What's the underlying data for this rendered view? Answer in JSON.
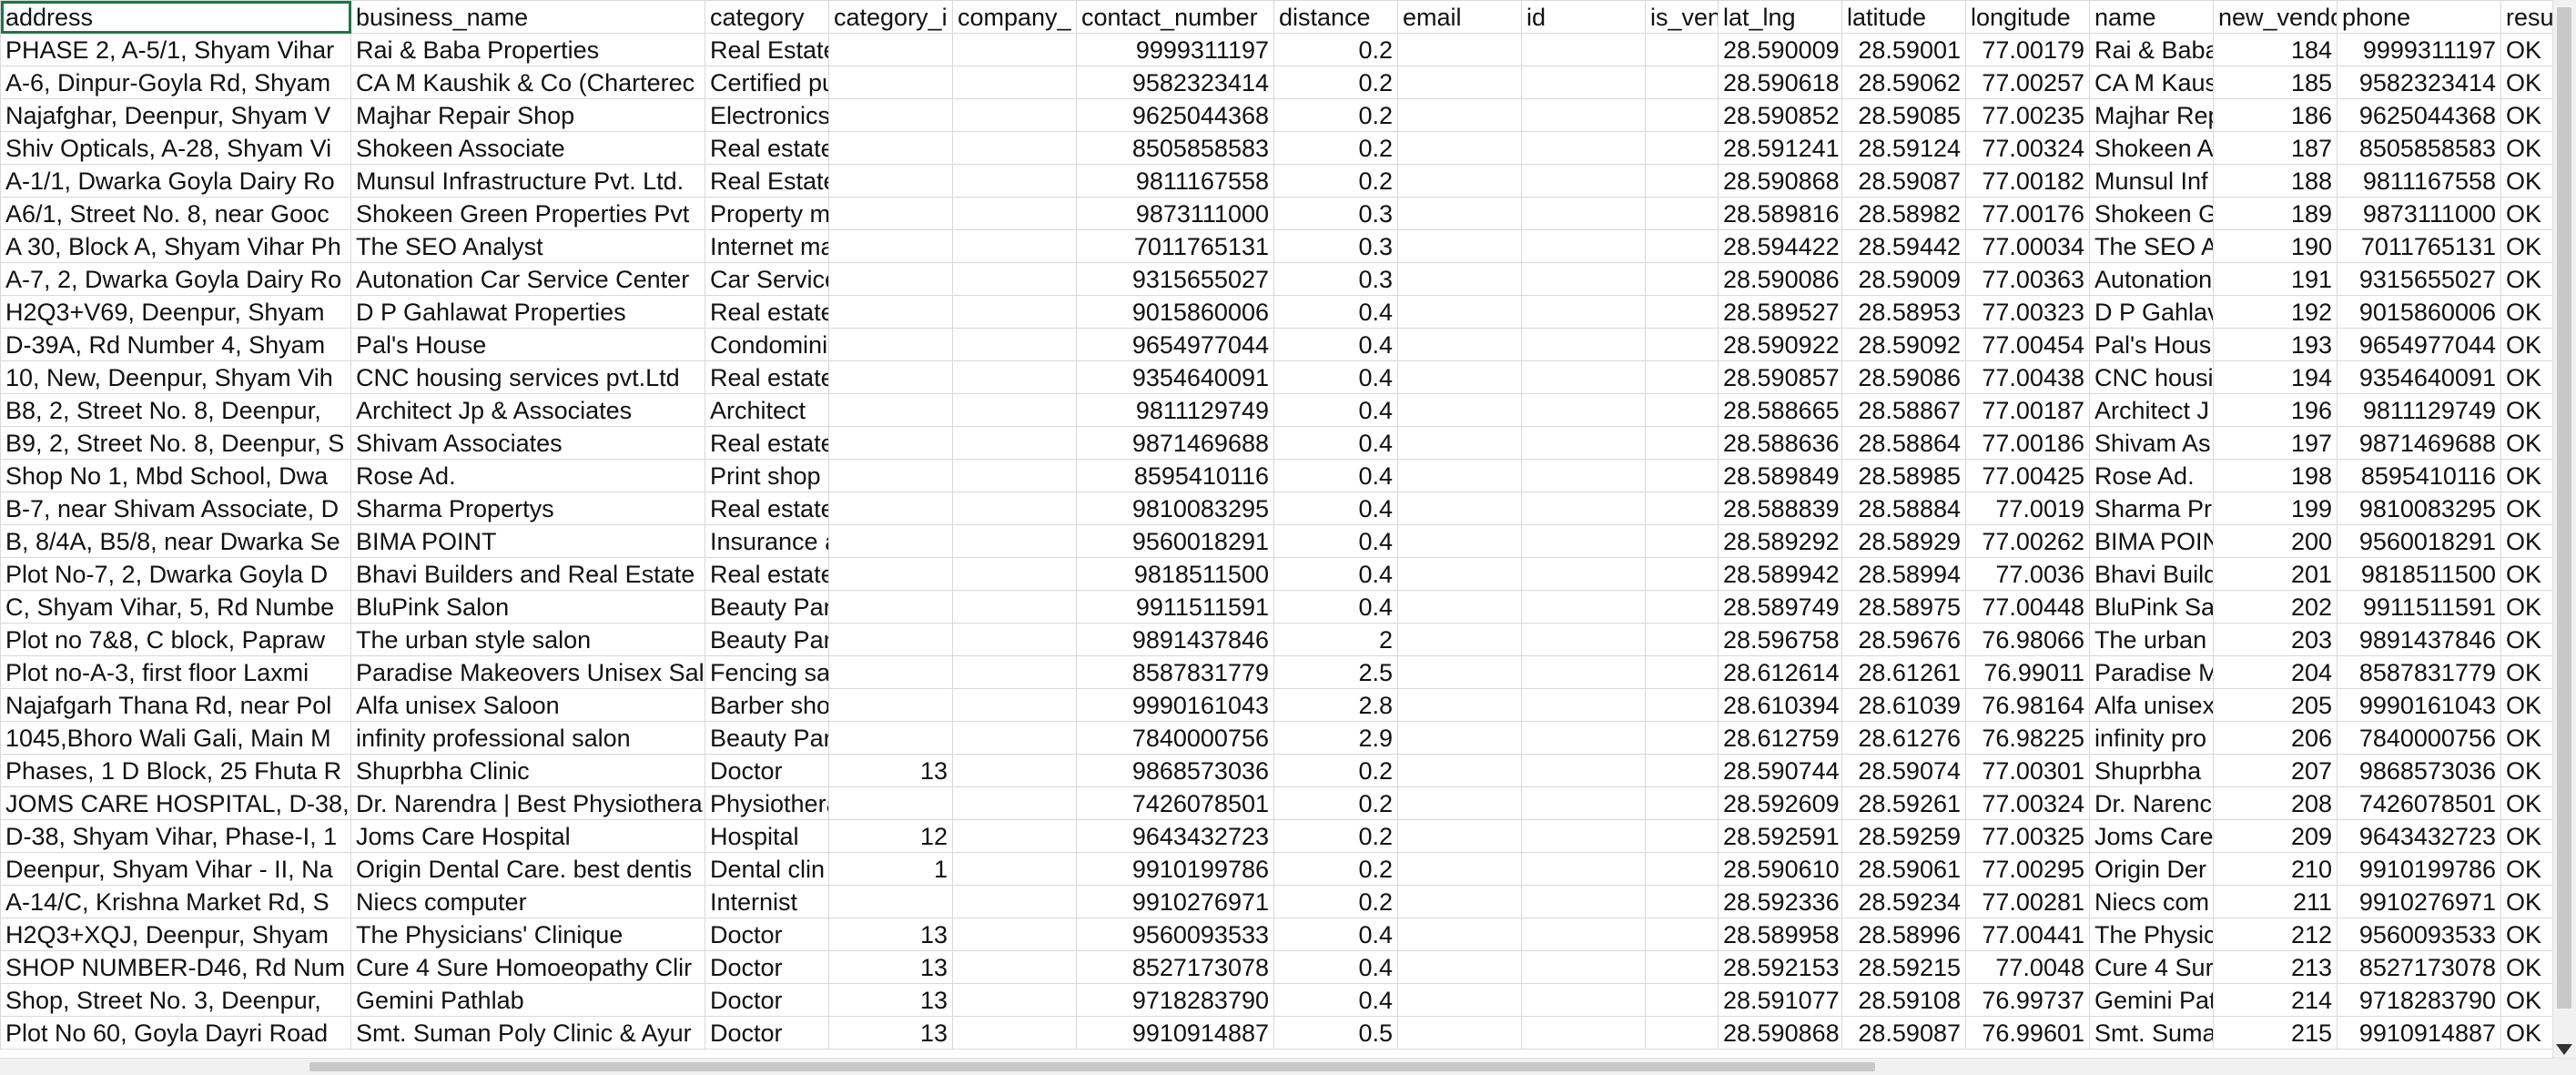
{
  "columns": [
    "address",
    "business_name",
    "category",
    "category_i",
    "company_",
    "contact_number",
    "distance",
    "email",
    "id",
    "is_ven",
    "lat_lng",
    "latitude",
    "longitude",
    "name",
    "new_vendo",
    "phone",
    "resu"
  ],
  "rows": [
    [
      "PHASE 2, A-5/1, Shyam Vihar",
      "Rai & Baba Properties",
      "Real Estate Builders & Construct",
      "",
      "",
      "9999311197",
      "0.2",
      "",
      "",
      "",
      "28.590009,",
      "28.59001",
      "77.00179",
      "Rai & Baba",
      "184",
      "9999311197",
      "OK"
    ],
    [
      "A-6, Dinpur-Goyla Rd, Shyam",
      "CA M Kaushik & Co (Charterec",
      "Certified public accountant",
      "",
      "",
      "9582323414",
      "0.2",
      "",
      "",
      "",
      "28.590618",
      "28.59062",
      "77.00257",
      "CA M Kaus",
      "185",
      "9582323414",
      "OK"
    ],
    [
      "Najafghar, Deenpur, Shyam V",
      "Majhar Repair Shop",
      "Electronics repair shop",
      "",
      "",
      "9625044368",
      "0.2",
      "",
      "",
      "",
      "28.590852",
      "28.59085",
      "77.00235",
      "Majhar Rep",
      "186",
      "9625044368",
      "OK"
    ],
    [
      "Shiv Opticals, A-28, Shyam Vi",
      "Shokeen Associate",
      "Real estate agency",
      "",
      "",
      "8505858583",
      "0.2",
      "",
      "",
      "",
      "28.591241",
      "28.59124",
      "77.00324",
      "Shokeen A",
      "187",
      "8505858583",
      "OK"
    ],
    [
      "A-1/1, Dwarka Goyla Dairy Ro",
      "Munsul Infrastructure Pvt. Ltd.",
      "Real Estate Builders & Construct",
      "",
      "",
      "9811167558",
      "0.2",
      "",
      "",
      "",
      "28.590868",
      "28.59087",
      "77.00182",
      "Munsul Inf",
      "188",
      "9811167558",
      "OK"
    ],
    [
      "A6/1, Street No. 8, near Gooc",
      "Shokeen Green Properties Pvt",
      "Property management company",
      "",
      "",
      "9873111000",
      "0.3",
      "",
      "",
      "",
      "28.589816",
      "28.58982",
      "77.00176",
      "Shokeen G",
      "189",
      "9873111000",
      "OK"
    ],
    [
      "A 30, Block A, Shyam Vihar Ph",
      "The SEO Analyst",
      "Internet marketing service",
      "",
      "",
      "7011765131",
      "0.3",
      "",
      "",
      "",
      "28.594422",
      "28.59442",
      "77.00034",
      "The SEO A",
      "190",
      "7011765131",
      "OK"
    ],
    [
      "A-7, 2, Dwarka Goyla Dairy Ro",
      "Autonation Car Service Center",
      "Car Service Station",
      "",
      "",
      "9315655027",
      "0.3",
      "",
      "",
      "",
      "28.590086",
      "28.59009",
      "77.00363",
      "Autonation",
      "191",
      "9315655027",
      "OK"
    ],
    [
      "H2Q3+V69, Deenpur, Shyam",
      "D P Gahlawat Properties",
      "Real estate consultant",
      "",
      "",
      "9015860006",
      "0.4",
      "",
      "",
      "",
      "28.589527",
      "28.58953",
      "77.00323",
      "D P Gahlav",
      "192",
      "9015860006",
      "OK"
    ],
    [
      "D-39A, Rd Number 4, Shyam",
      "Pal's House",
      "Condominium complex",
      "",
      "",
      "9654977044",
      "0.4",
      "",
      "",
      "",
      "28.590922",
      "28.59092",
      "77.00454",
      "Pal's Hous",
      "193",
      "9654977044",
      "OK"
    ],
    [
      "10, New, Deenpur, Shyam Vih",
      "CNC housing services pvt.Ltd",
      "Real estate agent",
      "",
      "",
      "9354640091",
      "0.4",
      "",
      "",
      "",
      "28.590857",
      "28.59086",
      "77.00438",
      "CNC housi",
      "194",
      "9354640091",
      "OK"
    ],
    [
      "B8, 2, Street No. 8, Deenpur,",
      "Architect Jp & Associates",
      "Architect",
      "",
      "",
      "9811129749",
      "0.4",
      "",
      "",
      "",
      "28.588665",
      "28.58867",
      "77.00187",
      "Architect J",
      "196",
      "9811129749",
      "OK"
    ],
    [
      "B9, 2, Street No. 8, Deenpur, S",
      "Shivam Associates",
      "Real estate agency",
      "",
      "",
      "9871469688",
      "0.4",
      "",
      "",
      "",
      "28.588636",
      "28.58864",
      "77.00186",
      "Shivam As",
      "197",
      "9871469688",
      "OK"
    ],
    [
      "Shop No 1, Mbd School, Dwa",
      "Rose Ad.",
      "Print shop",
      "",
      "",
      "8595410116",
      "0.4",
      "",
      "",
      "",
      "28.589849",
      "28.58985",
      "77.00425",
      "Rose Ad.",
      "198",
      "8595410116",
      "OK"
    ],
    [
      "B-7, near Shivam Associate, D",
      "Sharma Propertys",
      "Real estate agency",
      "",
      "",
      "9810083295",
      "0.4",
      "",
      "",
      "",
      "28.588839",
      "28.58884",
      "77.0019",
      "Sharma Pr",
      "199",
      "9810083295",
      "OK"
    ],
    [
      "B, 8/4A, B5/8, near Dwarka Se",
      "BIMA POINT",
      "Insurance agency",
      "",
      "",
      "9560018291",
      "0.4",
      "",
      "",
      "",
      "28.589292",
      "28.58929",
      "77.00262",
      "BIMA POIN",
      "200",
      "9560018291",
      "OK"
    ],
    [
      "Plot No-7, 2, Dwarka Goyla D",
      "Bhavi Builders and Real Estate",
      "Real estate consultant",
      "",
      "",
      "9818511500",
      "0.4",
      "",
      "",
      "",
      "28.589942",
      "28.58994",
      "77.0036",
      "Bhavi Build",
      "201",
      "9818511500",
      "OK"
    ],
    [
      "C, Shyam Vihar, 5, Rd Numbe",
      "BluPink Salon",
      "Beauty Parlour",
      "",
      "",
      "9911511591",
      "0.4",
      "",
      "",
      "",
      "28.589749",
      "28.58975",
      "77.00448",
      "BluPink Sal",
      "202",
      "9911511591",
      "OK"
    ],
    [
      "Plot no 7&8, C block, Papraw",
      "The urban style salon",
      "Beauty Parlour",
      "",
      "",
      "9891437846",
      "2",
      "",
      "",
      "",
      "28.596758",
      "28.59676",
      "76.98066",
      "The urban",
      "203",
      "9891437846",
      "OK"
    ],
    [
      "Plot no-A-3, first floor Laxmi",
      "Paradise Makeovers Unisex Sal",
      "Fencing salon",
      "",
      "",
      "8587831779",
      "2.5",
      "",
      "",
      "",
      "28.612614",
      "28.61261",
      "76.99011",
      "Paradise M",
      "204",
      "8587831779",
      "OK"
    ],
    [
      "Najafgarh Thana Rd, near Pol",
      "Alfa unisex Saloon",
      "Barber shop",
      "",
      "",
      "9990161043",
      "2.8",
      "",
      "",
      "",
      "28.610394",
      "28.61039",
      "76.98164",
      "Alfa unisex",
      "205",
      "9990161043",
      "OK"
    ],
    [
      "1045,Bhoro Wali Gali, Main M",
      "infinity professional salon",
      "Beauty Parlour",
      "",
      "",
      "7840000756",
      "2.9",
      "",
      "",
      "",
      "28.612759",
      "28.61276",
      "76.98225",
      "infinity pro",
      "206",
      "7840000756",
      "OK"
    ],
    [
      "Phases, 1 D Block, 25 Fhuta R",
      "Shuprbha Clinic",
      "Doctor",
      "13",
      "",
      "9868573036",
      "0.2",
      "",
      "",
      "",
      "28.590744",
      "28.59074",
      "77.00301",
      "Shuprbha",
      "207",
      "9868573036",
      "OK"
    ],
    [
      "JOMS CARE HOSPITAL, D-38,",
      "Dr. Narendra | Best Physiothera",
      "Physiotherapist",
      "",
      "",
      "7426078501",
      "0.2",
      "",
      "",
      "",
      "28.592609",
      "28.59261",
      "77.00324",
      "Dr. Narenc",
      "208",
      "7426078501",
      "OK"
    ],
    [
      "D-38, Shyam Vihar, Phase-I, 1",
      "Joms Care Hospital",
      "Hospital",
      "12",
      "",
      "9643432723",
      "0.2",
      "",
      "",
      "",
      "28.592591",
      "28.59259",
      "77.00325",
      "Joms Care",
      "209",
      "9643432723",
      "OK"
    ],
    [
      "Deenpur, Shyam Vihar - II, Na",
      "Origin Dental Care. best dentis",
      "Dental clin",
      "1",
      "",
      "9910199786",
      "0.2",
      "",
      "",
      "",
      "28.590610",
      "28.59061",
      "77.00295",
      "Origin Der",
      "210",
      "9910199786",
      "OK"
    ],
    [
      "A-14/C, Krishna Market Rd, S",
      "Niecs computer",
      "Internist",
      "",
      "",
      "9910276971",
      "0.2",
      "",
      "",
      "",
      "28.592336",
      "28.59234",
      "77.00281",
      "Niecs com",
      "211",
      "9910276971",
      "OK"
    ],
    [
      "H2Q3+XQJ, Deenpur, Shyam",
      "The Physicians' Clinique",
      "Doctor",
      "13",
      "",
      "9560093533",
      "0.4",
      "",
      "",
      "",
      "28.589958",
      "28.58996",
      "77.00441",
      "The Physic",
      "212",
      "9560093533",
      "OK"
    ],
    [
      "SHOP NUMBER-D46, Rd Num",
      "Cure 4 Sure Homoeopathy Clir",
      "Doctor",
      "13",
      "",
      "8527173078",
      "0.4",
      "",
      "",
      "",
      "28.592153",
      "28.59215",
      "77.0048",
      "Cure 4 Sur",
      "213",
      "8527173078",
      "OK"
    ],
    [
      "Shop, Street No. 3, Deenpur,",
      "Gemini Pathlab",
      "Doctor",
      "13",
      "",
      "9718283790",
      "0.4",
      "",
      "",
      "",
      "28.591077",
      "28.59108",
      "76.99737",
      "Gemini Pat",
      "214",
      "9718283790",
      "OK"
    ],
    [
      "Plot No 60, Goyla Dayri Road",
      "Smt. Suman Poly Clinic & Ayur",
      "Doctor",
      "13",
      "",
      "9910914887",
      "0.5",
      "",
      "",
      "",
      "28.590868",
      "28.59087",
      "76.99601",
      "Smt. Suma",
      "215",
      "9910914887",
      "OK"
    ]
  ],
  "numeric_columns": [
    3,
    5,
    6,
    10,
    11,
    12,
    14,
    15
  ]
}
